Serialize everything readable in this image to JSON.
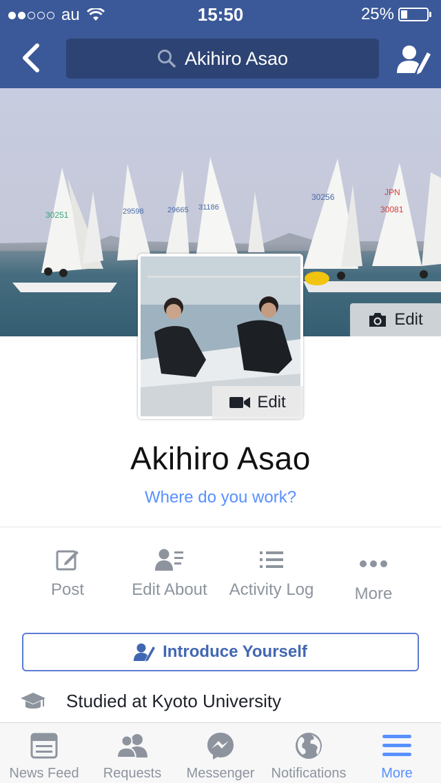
{
  "status_bar": {
    "carrier": "au",
    "time": "15:50",
    "battery": "25%"
  },
  "header": {
    "search_text": "Akihiro  Asao"
  },
  "cover": {
    "edit_label": "Edit"
  },
  "profile_picture": {
    "edit_label": "Edit"
  },
  "profile": {
    "name": "Akihiro  Asao",
    "work_prompt": "Where do you work?"
  },
  "actions": [
    {
      "label": "Post",
      "icon": "compose-icon"
    },
    {
      "label": "Edit About",
      "icon": "edit-about-icon"
    },
    {
      "label": "Activity Log",
      "icon": "list-icon"
    },
    {
      "label": "More",
      "icon": "more-dots-icon"
    }
  ],
  "introduce_button": {
    "label": "Introduce Yourself"
  },
  "about": {
    "studied": "Studied at Kyoto University"
  },
  "tab_bar": {
    "tabs": [
      {
        "label": "News Feed",
        "icon": "news-feed-icon"
      },
      {
        "label": "Requests",
        "icon": "friend-requests-icon"
      },
      {
        "label": "Messenger",
        "icon": "messenger-icon"
      },
      {
        "label": "Notifications",
        "icon": "globe-icon"
      },
      {
        "label": "More",
        "icon": "menu-icon"
      }
    ],
    "active": "More"
  },
  "colors": {
    "brand": "#3b5998",
    "link": "#5890ff",
    "active_tab": "#4267b2"
  }
}
